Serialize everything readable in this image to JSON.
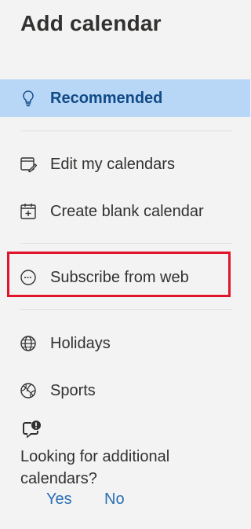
{
  "panel": {
    "title": "Add calendar"
  },
  "menu": {
    "recommended": {
      "label": "Recommended",
      "icon": "lightbulb-icon"
    },
    "edit": {
      "label": "Edit my calendars",
      "icon": "edit-calendar-icon"
    },
    "blank": {
      "label": "Create blank calendar",
      "icon": "add-calendar-icon"
    },
    "subscribe": {
      "label": "Subscribe from web",
      "icon": "web-subscribe-icon"
    },
    "holidays": {
      "label": "Holidays",
      "icon": "globe-icon"
    },
    "sports": {
      "label": "Sports",
      "icon": "basketball-icon"
    }
  },
  "feedback": {
    "question": "Looking for additional calendars?",
    "yes": "Yes",
    "no": "No",
    "icon": "feedback-alert-icon"
  },
  "colors": {
    "active_bg": "#b8d7f7",
    "active_text": "#114a86",
    "highlight": "#e0162b",
    "link": "#2b6fb6"
  }
}
